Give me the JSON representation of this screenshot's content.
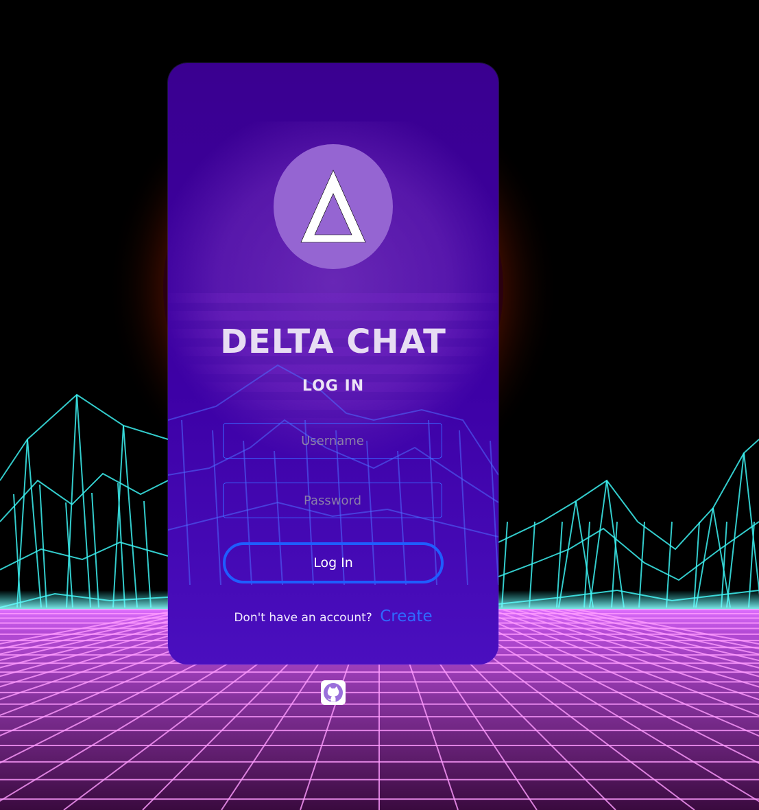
{
  "app": {
    "brand": "DELTA CHAT",
    "logo_icon": "delta-triangle-icon"
  },
  "login": {
    "heading": "LOG IN",
    "username_placeholder": "Username",
    "password_placeholder": "Password",
    "submit_label": "Log In",
    "signup_prompt": "Don't have an account?",
    "signup_link": "Create"
  },
  "footer": {
    "icon": "github-icon"
  },
  "colors": {
    "card": "#3d01a6",
    "logo_circle": "#9565d2",
    "accent_blue": "#1f5dff",
    "grid_pink": "#ff6bff",
    "mountain_cyan": "#3cf0f0",
    "sun_orange": "#ff5a10"
  }
}
